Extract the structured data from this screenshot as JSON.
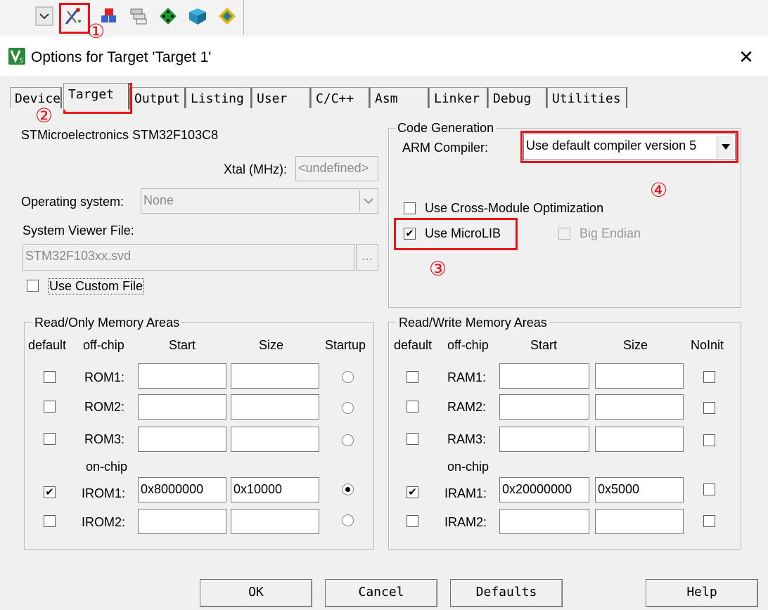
{
  "dialog": {
    "title": "Options for Target 'Target 1'"
  },
  "tabs": [
    {
      "label": "Device"
    },
    {
      "label": "Target"
    },
    {
      "label": "Output"
    },
    {
      "label": "Listing"
    },
    {
      "label": "User"
    },
    {
      "label": "C/C++"
    },
    {
      "label": "Asm"
    },
    {
      "label": "Linker"
    },
    {
      "label": "Debug"
    },
    {
      "label": "Utilities"
    }
  ],
  "target": {
    "device_name": "STMicroelectronics STM32F103C8",
    "xtal_label": "Xtal (MHz):",
    "xtal_value": "<undefined>",
    "os_label": "Operating system:",
    "os_value": "None",
    "svf_label": "System Viewer File:",
    "svf_value": "STM32F103xx.svd",
    "browse_label": "...",
    "custom_file_label": "Use Custom File"
  },
  "codegen": {
    "title": "Code Generation",
    "compiler_label": "ARM Compiler:",
    "compiler_value": "Use default compiler version 5",
    "cross_module_label": "Use Cross-Module Optimization",
    "microlib_label": "Use MicroLIB",
    "big_endian_label": "Big Endian"
  },
  "rom": {
    "title": "Read/Only Memory Areas",
    "headers": {
      "default": "default",
      "offchip": "off-chip",
      "start": "Start",
      "size": "Size",
      "startup": "Startup"
    },
    "onchip_label": "on-chip",
    "rows": [
      {
        "name": "ROM1:",
        "start": "",
        "size": ""
      },
      {
        "name": "ROM2:",
        "start": "",
        "size": ""
      },
      {
        "name": "ROM3:",
        "start": "",
        "size": ""
      },
      {
        "name": "IROM1:",
        "start": "0x8000000",
        "size": "0x10000"
      },
      {
        "name": "IROM2:",
        "start": "",
        "size": ""
      }
    ]
  },
  "ram": {
    "title": "Read/Write Memory Areas",
    "headers": {
      "default": "default",
      "offchip": "off-chip",
      "start": "Start",
      "size": "Size",
      "noinit": "NoInit"
    },
    "onchip_label": "on-chip",
    "rows": [
      {
        "name": "RAM1:",
        "start": "",
        "size": ""
      },
      {
        "name": "RAM2:",
        "start": "",
        "size": ""
      },
      {
        "name": "RAM3:",
        "start": "",
        "size": ""
      },
      {
        "name": "IRAM1:",
        "start": "0x20000000",
        "size": "0x5000"
      },
      {
        "name": "IRAM2:",
        "start": "",
        "size": ""
      }
    ]
  },
  "buttons": {
    "ok": "OK",
    "cancel": "Cancel",
    "defaults": "Defaults",
    "help": "Help"
  },
  "annotations": {
    "n1": "①",
    "n2": "②",
    "n3": "③",
    "n4": "④"
  },
  "checkmark": "✔",
  "icons": [
    "dropdown-icon",
    "options-for-target-icon",
    "manage-components-icon",
    "batch-build-icon",
    "select-device-icon",
    "pack-installer-icon",
    "run-time-env-icon",
    "keil-logo-icon",
    "close-icon"
  ],
  "colors": {
    "annotation_red": "#e8141a"
  }
}
